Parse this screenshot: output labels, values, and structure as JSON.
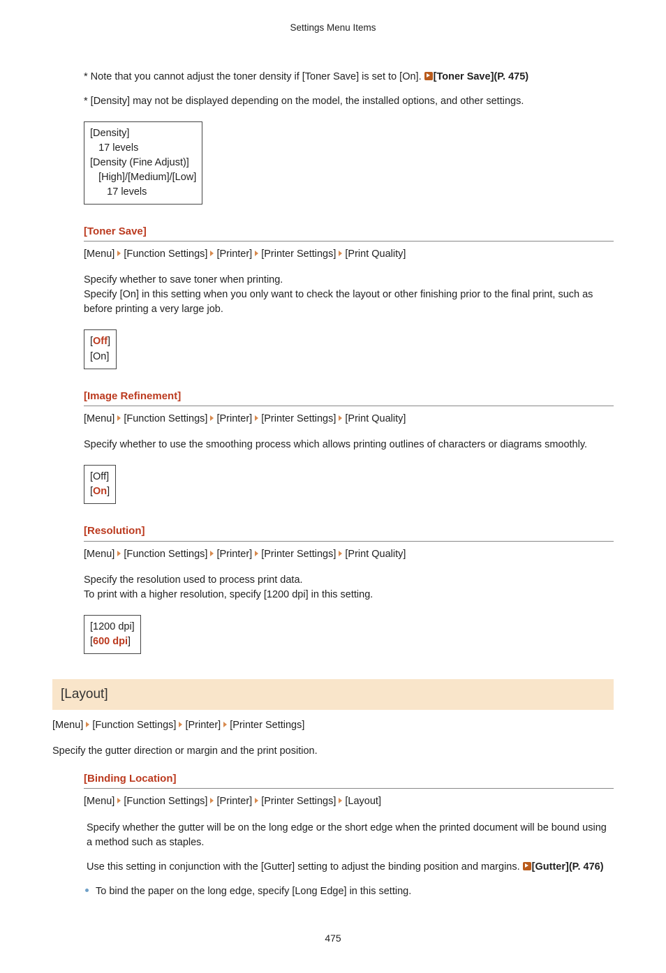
{
  "header": "Settings Menu Items",
  "note1_prefix": "* Note that you cannot adjust the toner density if [Toner Save] is set to [On]. ",
  "note1_link": "[Toner Save](P. 475)",
  "note2": "* [Density] may not be displayed depending on the model, the installed options, and other settings.",
  "density_box": {
    "l1": "[Density]",
    "l2": "   17 levels",
    "l3": "",
    "l4": "[Density (Fine Adjust)]",
    "l5": "   [High]/[Medium]/[Low]",
    "l6": "      17 levels"
  },
  "toner_save": {
    "title": "[Toner Save]",
    "bc": [
      "[Menu]",
      "[Function Settings]",
      "[Printer]",
      "[Printer Settings]",
      "[Print Quality]"
    ],
    "p1": "Specify whether to save toner when printing.",
    "p2": "Specify [On] in this setting when you only want to check the layout or other finishing prior to the final print, such as before printing a very large job.",
    "opt_default": "Off",
    "opt2": "[On]"
  },
  "image_ref": {
    "title": "[Image Refinement]",
    "bc": [
      "[Menu]",
      "[Function Settings]",
      "[Printer]",
      "[Printer Settings]",
      "[Print Quality]"
    ],
    "p1": "Specify whether to use the smoothing process which allows printing outlines of characters or diagrams smoothly.",
    "opt1": "[Off]",
    "opt_default": "On"
  },
  "resolution": {
    "title": "[Resolution]",
    "bc": [
      "[Menu]",
      "[Function Settings]",
      "[Printer]",
      "[Printer Settings]",
      "[Print Quality]"
    ],
    "p1": "Specify the resolution used to process print data.",
    "p2": "To print with a higher resolution, specify [1200 dpi] in this setting.",
    "opt1": "[1200 dpi]",
    "opt_default": "600 dpi"
  },
  "layout": {
    "bar": "[Layout]",
    "bc": [
      "[Menu]",
      "[Function Settings]",
      "[Printer]",
      "[Printer Settings]"
    ],
    "p1": "Specify the gutter direction or margin and the print position."
  },
  "binding": {
    "title": "[Binding Location]",
    "bc": [
      "[Menu]",
      "[Function Settings]",
      "[Printer]",
      "[Printer Settings]",
      "[Layout]"
    ],
    "p1": "Specify whether the gutter will be on the long edge or the short edge when the printed document will be bound using a method such as staples.",
    "p2a": "Use this setting in conjunction with the [Gutter] setting to adjust the binding position and margins. ",
    "p2_link": "[Gutter](P. 476)",
    "bullet": "To bind the paper on the long edge, specify [Long Edge] in this setting."
  },
  "page_number": "475"
}
